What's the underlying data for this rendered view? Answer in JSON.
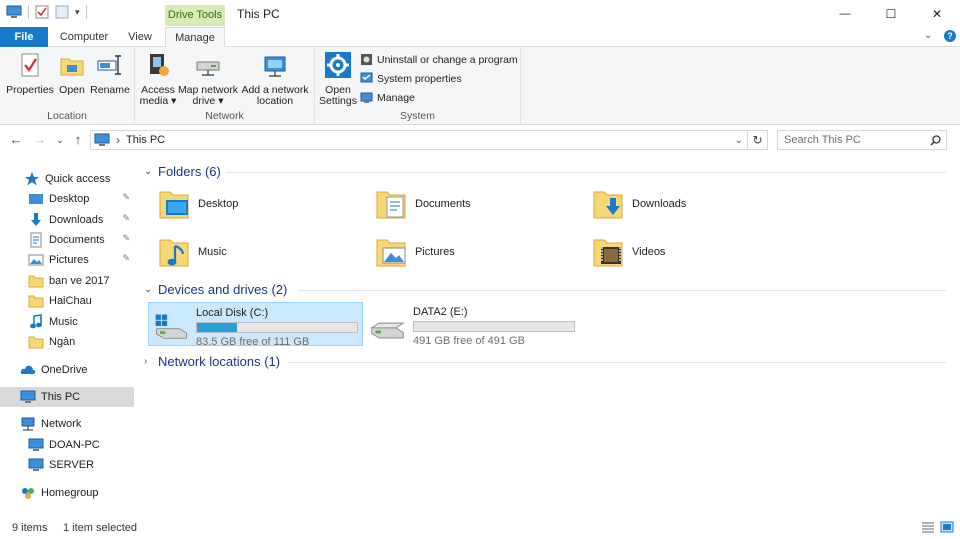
{
  "window": {
    "title": "This PC",
    "contextual_tab": "Drive Tools",
    "minimize_glyph": "—",
    "maximize_glyph": "☐",
    "close_glyph": "✕"
  },
  "tabs": {
    "file": "File",
    "computer": "Computer",
    "view": "View",
    "manage": "Manage",
    "collapse_glyph": "⌄",
    "help_glyph": "?"
  },
  "ribbon": {
    "location": {
      "label": "Location",
      "properties": "Properties",
      "open": "Open",
      "rename": "Rename"
    },
    "network": {
      "label": "Network",
      "access_media_1": "Access",
      "access_media_2": "media ▾",
      "map_drive_1": "Map network",
      "map_drive_2": "drive ▾",
      "add_location_1": "Add a network",
      "add_location_2": "location"
    },
    "system": {
      "label": "System",
      "open_settings_1": "Open",
      "open_settings_2": "Settings",
      "uninstall": "Uninstall or change a program",
      "system_properties": "System properties",
      "manage": "Manage"
    }
  },
  "address": {
    "back": "←",
    "forward": "→",
    "recent": "⌄",
    "up": "↑",
    "separator": "›",
    "path": "This PC",
    "dropdown": "⌄",
    "refresh": "↻",
    "search_placeholder": "Search This PC"
  },
  "nav": {
    "quick_access": "Quick access",
    "items": [
      {
        "label": "Desktop",
        "pinned": true
      },
      {
        "label": "Downloads",
        "pinned": true
      },
      {
        "label": "Documents",
        "pinned": true
      },
      {
        "label": "Pictures",
        "pinned": true
      },
      {
        "label": "ban ve 2017",
        "pinned": false
      },
      {
        "label": "HaiChau",
        "pinned": false
      },
      {
        "label": "Music",
        "pinned": false
      },
      {
        "label": "Ngàn",
        "pinned": false
      }
    ],
    "onedrive": "OneDrive",
    "this_pc": "This PC",
    "network": "Network",
    "network_items": [
      "DOAN-PC",
      "SERVER"
    ],
    "homegroup": "Homegroup",
    "pin_glyph": "📌"
  },
  "content": {
    "folders_header": "Folders (6)",
    "folders": [
      {
        "name": "Desktop"
      },
      {
        "name": "Documents"
      },
      {
        "name": "Downloads"
      },
      {
        "name": "Music"
      },
      {
        "name": "Pictures"
      },
      {
        "name": "Videos"
      }
    ],
    "devices_header": "Devices and drives (2)",
    "drives": [
      {
        "name": "Local Disk (C:)",
        "free": "83.5 GB free of 111 GB",
        "used_fraction": 0.25,
        "selected": true
      },
      {
        "name": "DATA2 (E:)",
        "free": "491 GB free of 491 GB",
        "used_fraction": 0.0,
        "selected": false
      }
    ],
    "network_header": "Network locations (1)",
    "expanded_glyph": "⌄",
    "collapsed_glyph": "›"
  },
  "status": {
    "items": "9 items",
    "selected": "1 item selected"
  },
  "colors": {
    "accent": "#1979ca",
    "selection": "#cce8ff",
    "drive_fill": "#26a0da",
    "folder": "#f8d775"
  }
}
